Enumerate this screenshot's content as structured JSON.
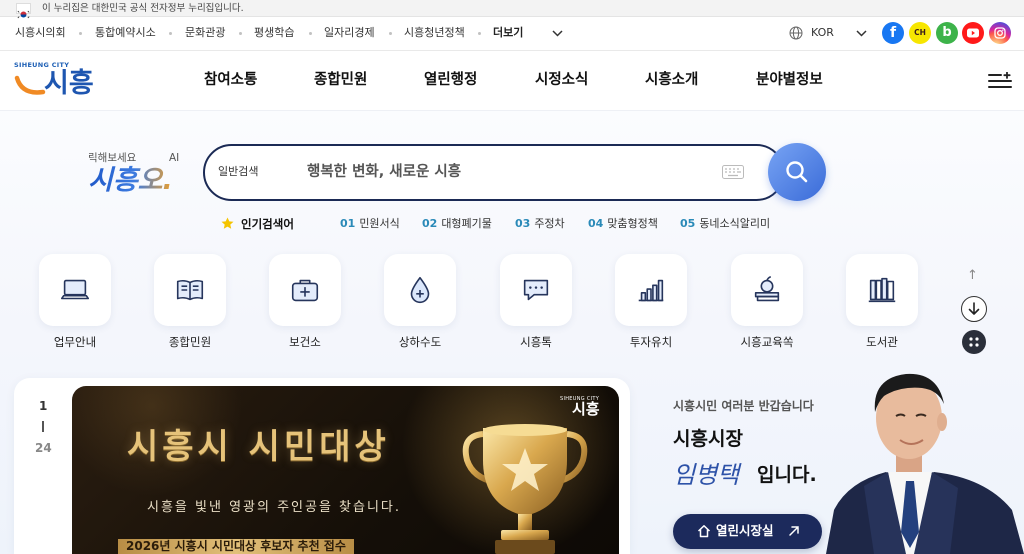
{
  "notice": {
    "text": "이 누리집은 대한민국 공식 전자정부 누리집입니다."
  },
  "utility": {
    "links": [
      "시흥시의회",
      "통합예약시소",
      "문화관광",
      "평생학습",
      "일자리경제",
      "시흥청년정책"
    ],
    "more": "더보기",
    "language": "KOR"
  },
  "social": [
    {
      "icon": "facebook-icon",
      "glyph": "f",
      "color": "#1877f2"
    },
    {
      "icon": "kakao-channel-icon",
      "glyph": "CH",
      "color": "#f7e600"
    },
    {
      "icon": "blog-icon",
      "glyph": "b",
      "color": "#3db34a"
    },
    {
      "icon": "youtube-icon",
      "color": "#ff1a1a"
    },
    {
      "icon": "instagram-icon",
      "color": "#d6249f"
    }
  ],
  "header": {
    "logo_small": "SIHEUNG CITY",
    "logo_text": "시흥",
    "nav": [
      "참여소통",
      "종합민원",
      "열린행정",
      "시정소식",
      "시흥소개",
      "분야별정보"
    ]
  },
  "search": {
    "ai_hint": "릭해보세요",
    "ai_badge": "AI",
    "ai_logo": "시흥오.",
    "category": "일반검색",
    "placeholder": "행복한 변화, 새로운 시흥"
  },
  "popular": {
    "title": "인기검색어",
    "items": [
      {
        "rank": "01",
        "label": "민원서식"
      },
      {
        "rank": "02",
        "label": "대형폐기물"
      },
      {
        "rank": "03",
        "label": "주정차"
      },
      {
        "rank": "04",
        "label": "맞춤형정책"
      },
      {
        "rank": "05",
        "label": "동네소식알리미"
      }
    ]
  },
  "quick_links": [
    {
      "label": "업무안내",
      "icon": "laptop-icon"
    },
    {
      "label": "종합민원",
      "icon": "book-icon"
    },
    {
      "label": "보건소",
      "icon": "medical-kit-icon"
    },
    {
      "label": "상하수도",
      "icon": "water-drop-icon"
    },
    {
      "label": "시흥톡",
      "icon": "chat-bubble-icon"
    },
    {
      "label": "투자유치",
      "icon": "bar-chart-icon"
    },
    {
      "label": "시흥교육쏙",
      "icon": "apple-books-icon"
    },
    {
      "label": "도서관",
      "icon": "library-books-icon"
    }
  ],
  "banner": {
    "current": "1",
    "total": "24",
    "title": "시흥시 시민대상",
    "subtitle": "시흥을 빛낸 영광의 주인공을 찾습니다.",
    "footer": "2026년 시흥시 시민대상 후보자 추천 접수",
    "logo_small": "SIHEUNG CITY",
    "logo_text": "시흥"
  },
  "mayor": {
    "greeting": "시흥시민 여러분 반갑습니다",
    "title": "시흥시장",
    "name": "임병택",
    "suffix": "입니다.",
    "button": "열린시장실"
  },
  "colors": {
    "brand_blue": "#1e56b0",
    "navy": "#1b2a55",
    "accent_orange": "#f08a24",
    "rank_blue": "#2a8ab8",
    "gold": "#e6c37a",
    "search_button": "#3a6bd8"
  }
}
